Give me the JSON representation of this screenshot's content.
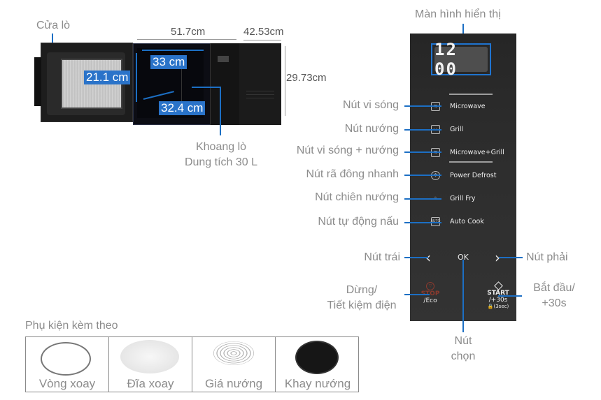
{
  "microwave": {
    "door_label": "Cửa lò",
    "dimensions": {
      "width": "51.7cm",
      "depth": "42.53cm",
      "height": "29.73cm",
      "cavity_width": "33 cm",
      "cavity_height": "21.1 cm",
      "cavity_depth": "32.4 cm"
    },
    "cavity_label": "Khoang lò",
    "capacity_label": "Dung tích 30 L"
  },
  "panel": {
    "display_title": "Màn hình hiển thị",
    "display_value": "12 00",
    "buttons": [
      {
        "label": "Microwave",
        "callout": "Nút vi sóng",
        "icon": "microwave-icon"
      },
      {
        "label": "Grill",
        "callout": "Nút nướng",
        "icon": "grill-icon"
      },
      {
        "label": "Microwave+Grill",
        "callout": "Nút vi sóng + nướng",
        "icon": "microwave-grill-icon"
      },
      {
        "label": "Power Defrost",
        "callout": "Nút rã đông nhanh",
        "icon": "defrost-icon"
      },
      {
        "label": "Grill Fry",
        "callout": "Nút chiên nướng",
        "icon": "grill-fry-icon"
      },
      {
        "label": "Auto Cook",
        "callout": "Nút tự động nấu",
        "icon": "auto-cook-icon"
      }
    ],
    "left": {
      "glyph": "‹",
      "callout": "Nút trái"
    },
    "ok": {
      "label": "OK",
      "callout_line1": "Nút",
      "callout_line2": "chọn"
    },
    "right": {
      "glyph": "›",
      "callout": "Nút phải"
    },
    "stop": {
      "label": "STOP",
      "sub": "/Eco",
      "callout_line1": "Dừng/",
      "callout_line2": "Tiết kiệm điện",
      "color": "#8a3a2e"
    },
    "start": {
      "label": "START",
      "sub": "/+30s",
      "lock": "(3sec)",
      "callout_line1": "Bắt đầu/",
      "callout_line2": "+30s"
    },
    "auto_icon_text": "AUTO"
  },
  "accessories": {
    "title": "Phụ kiện kèm theo",
    "items": [
      {
        "label": "Vòng xoay"
      },
      {
        "label": "Đĩa xoay"
      },
      {
        "label": "Giá nướng"
      },
      {
        "label": "Khay nướng"
      }
    ]
  },
  "colors": {
    "accent": "#1c6fc4",
    "label_bg": "#2a73c9",
    "panel_bg": "#2b2b2b",
    "text": "#8c8c8c"
  }
}
